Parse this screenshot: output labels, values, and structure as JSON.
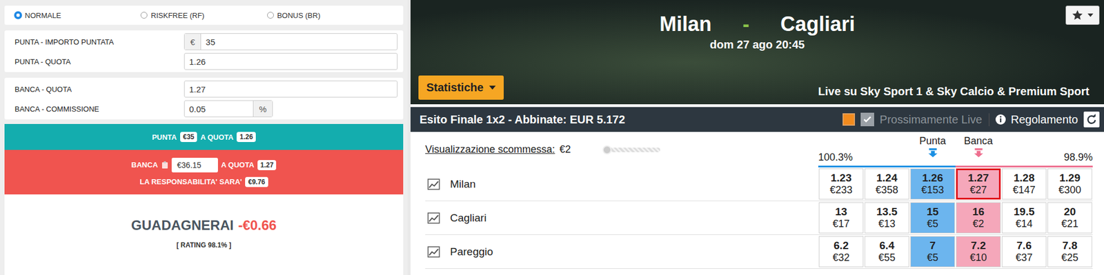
{
  "calculator": {
    "modes": [
      {
        "label": "NORMALE",
        "selected": true
      },
      {
        "label": "RISKFREE (RF)",
        "selected": false
      },
      {
        "label": "BONUS (BR)",
        "selected": false
      }
    ],
    "field_groups": [
      [
        {
          "label": "PUNTA - IMPORTO PUNTATA",
          "prefix": "€",
          "value": "35"
        },
        {
          "label": "PUNTA - QUOTA",
          "value": "1.26"
        }
      ],
      [
        {
          "label": "BANCA - QUOTA",
          "value": "1.27"
        },
        {
          "label": "BANCA - COMMISSIONE",
          "value": "0.05",
          "suffix": "%"
        }
      ]
    ],
    "back_bar": {
      "label": "PUNTA",
      "stake": "€35",
      "odds_label": "A QUOTA",
      "odds": "1.26"
    },
    "lay_bar": {
      "label": "BANCA",
      "stake": "€36.15",
      "odds_label": "A QUOTA",
      "odds": "1.27",
      "liability_label": "LA RESPONSABILITA' SARA'",
      "liability": "€9.76"
    },
    "result": {
      "label": "GUADAGNERAI",
      "value": "-€0.66",
      "rating": "[ RATING 98.1% ]"
    }
  },
  "event": {
    "home": "Milan",
    "separator": "-",
    "away": "Cagliari",
    "date": "dom 27 ago 20:45",
    "stats_button": "Statistiche",
    "broadcast": "Live su Sky Sport 1 & Sky Calcio & Premium Sport"
  },
  "market": {
    "title": "Esito Finale 1x2 - Abbinate: EUR 5.172",
    "live_checked": true,
    "live_label": "Prossimamente Live",
    "rules": "Regolamento"
  },
  "view": {
    "label": "Visualizzazione scommessa:",
    "value": "€2",
    "level": 0
  },
  "ladder": {
    "back_percent": "100.3%",
    "back_label": "Punta",
    "lay_label": "Banca",
    "lay_percent": "98.9%"
  },
  "runners": [
    {
      "name": "Milan",
      "cells": [
        {
          "price": "1.23",
          "amount": "€233",
          "kind": "back",
          "best": false,
          "selected": false
        },
        {
          "price": "1.24",
          "amount": "€358",
          "kind": "back",
          "best": false,
          "selected": false
        },
        {
          "price": "1.26",
          "amount": "€153",
          "kind": "back",
          "best": true,
          "selected": false
        },
        {
          "price": "1.27",
          "amount": "€27",
          "kind": "lay",
          "best": true,
          "selected": true
        },
        {
          "price": "1.28",
          "amount": "€147",
          "kind": "lay",
          "best": false,
          "selected": false
        },
        {
          "price": "1.29",
          "amount": "€300",
          "kind": "lay",
          "best": false,
          "selected": false
        }
      ]
    },
    {
      "name": "Cagliari",
      "cells": [
        {
          "price": "13",
          "amount": "€17",
          "kind": "back",
          "best": false,
          "selected": false
        },
        {
          "price": "13.5",
          "amount": "€13",
          "kind": "back",
          "best": false,
          "selected": false
        },
        {
          "price": "15",
          "amount": "€5",
          "kind": "back",
          "best": true,
          "selected": false
        },
        {
          "price": "16",
          "amount": "€2",
          "kind": "lay",
          "best": true,
          "selected": false
        },
        {
          "price": "19.5",
          "amount": "€14",
          "kind": "lay",
          "best": false,
          "selected": false
        },
        {
          "price": "20",
          "amount": "€21",
          "kind": "lay",
          "best": false,
          "selected": false
        }
      ]
    },
    {
      "name": "Pareggio",
      "cells": [
        {
          "price": "6.2",
          "amount": "€32",
          "kind": "back",
          "best": false,
          "selected": false
        },
        {
          "price": "6.4",
          "amount": "€55",
          "kind": "back",
          "best": false,
          "selected": false
        },
        {
          "price": "7",
          "amount": "€5",
          "kind": "back",
          "best": true,
          "selected": false
        },
        {
          "price": "7.2",
          "amount": "€10",
          "kind": "lay",
          "best": true,
          "selected": false
        },
        {
          "price": "7.6",
          "amount": "€37",
          "kind": "lay",
          "best": false,
          "selected": false
        },
        {
          "price": "7.8",
          "amount": "€25",
          "kind": "lay",
          "best": false,
          "selected": false
        }
      ]
    }
  ]
}
